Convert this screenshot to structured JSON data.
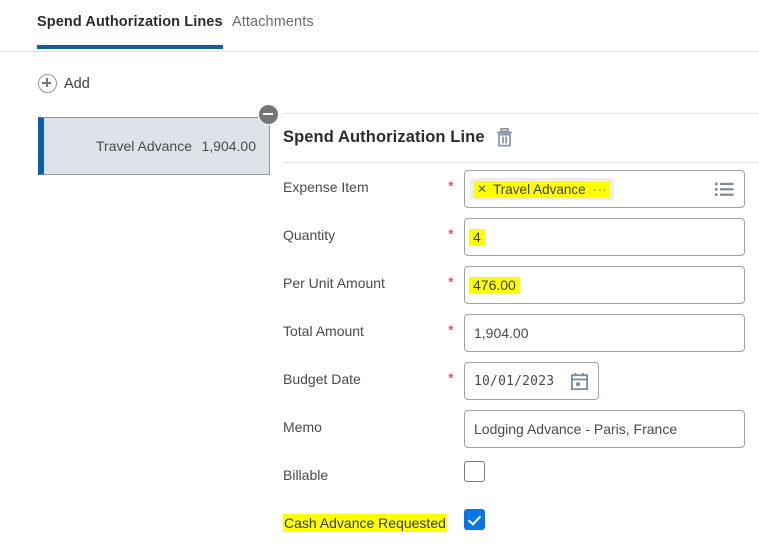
{
  "tabs": [
    {
      "label": "Spend Authorization Lines",
      "active": true
    },
    {
      "label": "Attachments",
      "active": false
    }
  ],
  "toolbar": {
    "add_label": "Add",
    "add_icon": "plus-circle-icon"
  },
  "lines_panel": {
    "remove_icon": "minus-circle-icon",
    "items": [
      {
        "name": "Travel Advance",
        "amount": "1,904.00"
      }
    ]
  },
  "detail": {
    "title": "Spend Authorization Line",
    "delete_icon": "trash-icon",
    "fields": {
      "expense_item": {
        "label": "Expense Item",
        "required": "*",
        "chip_remove_icon": "close-icon",
        "chip_value": "Travel Advance",
        "chip_overflow": "···",
        "prompt_icon": "list-menu-icon",
        "highlighted": true
      },
      "quantity": {
        "label": "Quantity",
        "required": "*",
        "value": "4",
        "highlighted": true
      },
      "per_unit_amount": {
        "label": "Per Unit Amount",
        "required": "*",
        "value": "476.00",
        "highlighted": true
      },
      "total_amount": {
        "label": "Total Amount",
        "required": "*",
        "value": "1,904.00",
        "highlighted": false
      },
      "budget_date": {
        "label": "Budget Date",
        "required": "*",
        "value": "10/01/2023",
        "calendar_icon": "calendar-icon",
        "highlighted": false
      },
      "memo": {
        "label": "Memo",
        "required": "",
        "value": "Lodging Advance - Paris, France",
        "highlighted": false
      },
      "billable": {
        "label": "Billable",
        "checked": false,
        "highlighted": false
      },
      "cash_advance_requested": {
        "label": "Cash Advance Requested",
        "checked": true,
        "highlighted": true
      }
    }
  },
  "colors": {
    "accent_blue": "#0875e1",
    "tab_underline": "#0f5fa5",
    "card_border_left": "#0a5fa8",
    "card_background": "#dde3e9",
    "required_red": "#e03a3a",
    "highlight_yellow": "#ffff00",
    "icon_gray": "#7d8b99"
  }
}
